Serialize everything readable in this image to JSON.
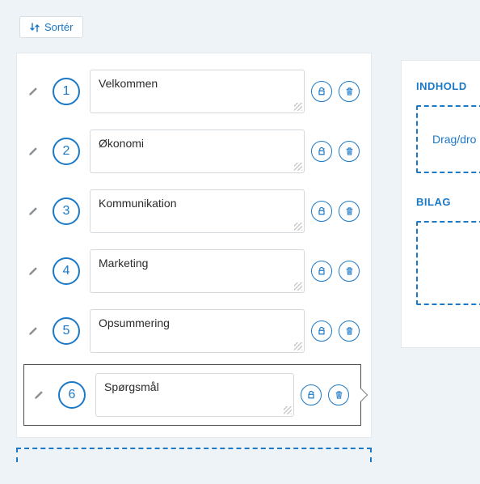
{
  "sort_button_label": "Sortér",
  "items": [
    {
      "num": "1",
      "title": "Velkommen",
      "active": false
    },
    {
      "num": "2",
      "title": "Økonomi",
      "active": false
    },
    {
      "num": "3",
      "title": "Kommunikation",
      "active": false
    },
    {
      "num": "4",
      "title": "Marketing",
      "active": false
    },
    {
      "num": "5",
      "title": "Opsummering",
      "active": false
    },
    {
      "num": "6",
      "title": "Spørgsmål",
      "active": true
    }
  ],
  "sidebar": {
    "content_heading": "INDHOLD",
    "dropzone_text": "Drag/dro",
    "attachments_heading": "BILAG"
  }
}
